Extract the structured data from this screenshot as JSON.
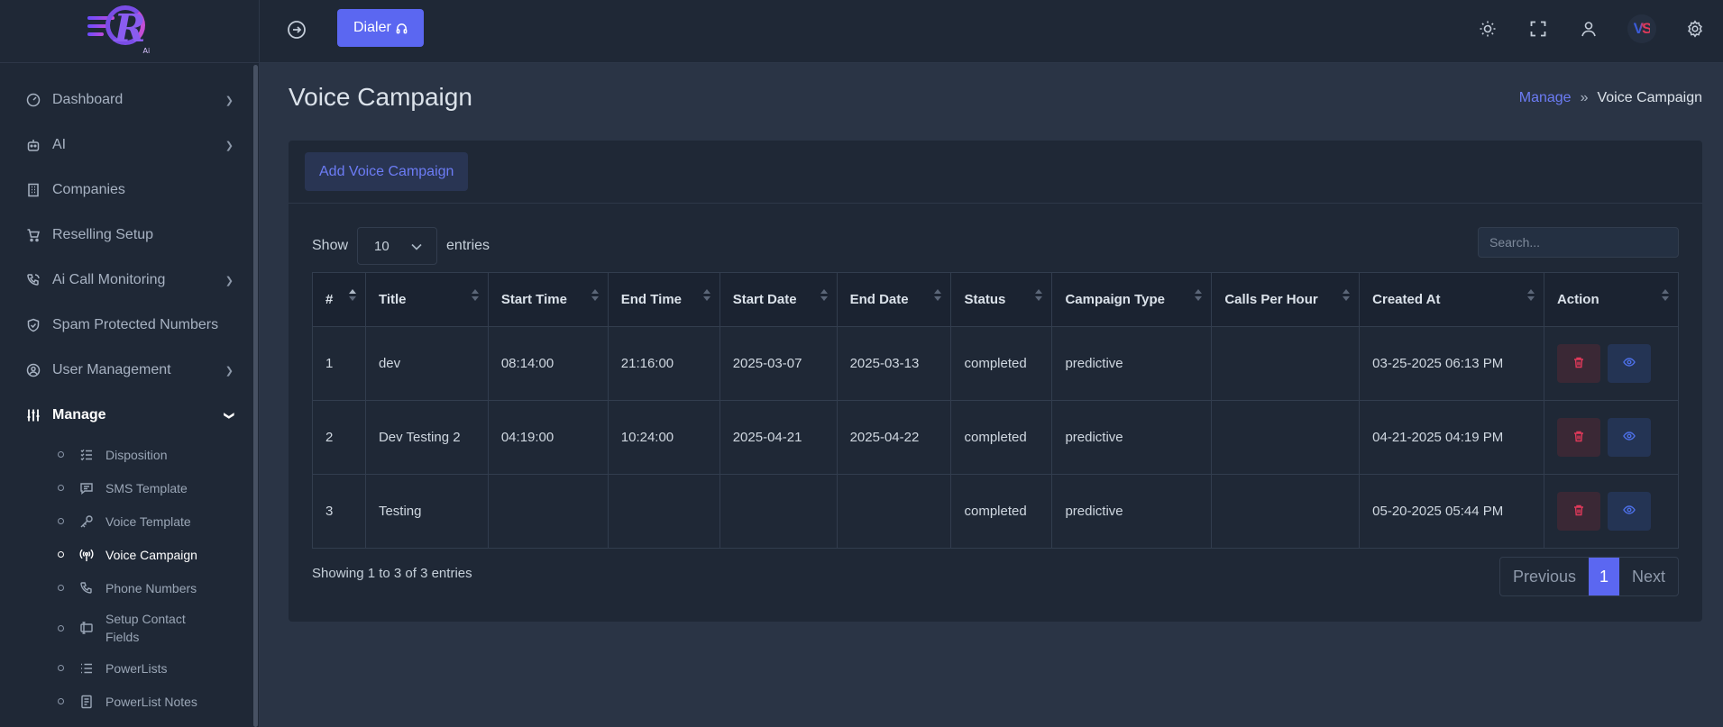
{
  "sidebar": {
    "items": [
      {
        "label": "Dashboard",
        "icon": "gauge-icon",
        "chevron": true
      },
      {
        "label": "AI",
        "icon": "robot-icon",
        "chevron": true
      },
      {
        "label": "Companies",
        "icon": "building-icon",
        "chevron": false
      },
      {
        "label": "Reselling Setup",
        "icon": "cart-icon",
        "chevron": false
      },
      {
        "label": "Ai Call Monitoring",
        "icon": "phone-call-icon",
        "chevron": true
      },
      {
        "label": "Spam Protected Numbers",
        "icon": "shield-icon",
        "chevron": false
      },
      {
        "label": "User Management",
        "icon": "user-circle-icon",
        "chevron": true
      },
      {
        "label": "Manage",
        "icon": "sliders-icon",
        "chevron": true
      }
    ],
    "sub_items": [
      {
        "label": "Disposition",
        "icon": "checklist-icon"
      },
      {
        "label": "SMS Template",
        "icon": "message-icon"
      },
      {
        "label": "Voice Template",
        "icon": "key-icon"
      },
      {
        "label": "Voice Campaign",
        "icon": "broadcast-icon"
      },
      {
        "label": "Phone Numbers",
        "icon": "phone-icon"
      },
      {
        "label": "Setup Contact Fields",
        "icon": "form-icon"
      },
      {
        "label": "PowerLists",
        "icon": "list-icon"
      },
      {
        "label": "PowerList Notes",
        "icon": "note-icon"
      }
    ]
  },
  "topbar": {
    "dialer_label": "Dialer",
    "avatar_text": "VS"
  },
  "page": {
    "title": "Voice Campaign",
    "breadcrumb": {
      "parent": "Manage",
      "current": "Voice Campaign"
    }
  },
  "card": {
    "add_label": "Add Voice Campaign",
    "show_label": "Show",
    "entries_value": "10",
    "entries_label": "entries",
    "search_placeholder": "Search..."
  },
  "table": {
    "columns": [
      "#",
      "Title",
      "Start Time",
      "End Time",
      "Start Date",
      "End Date",
      "Status",
      "Campaign Type",
      "Calls Per Hour",
      "Created At",
      "Action"
    ],
    "rows": [
      {
        "num": "1",
        "title": "dev",
        "start_time": "08:14:00",
        "end_time": "21:16:00",
        "start_date": "2025-03-07",
        "end_date": "2025-03-13",
        "status": "completed",
        "type": "predictive",
        "cph": "",
        "created": "03-25-2025 06:13 PM"
      },
      {
        "num": "2",
        "title": "Dev Testing 2",
        "start_time": "04:19:00",
        "end_time": "10:24:00",
        "start_date": "2025-04-21",
        "end_date": "2025-04-22",
        "status": "completed",
        "type": "predictive",
        "cph": "",
        "created": "04-21-2025 04:19 PM"
      },
      {
        "num": "3",
        "title": "Testing",
        "start_time": "",
        "end_time": "",
        "start_date": "",
        "end_date": "",
        "status": "completed",
        "type": "predictive",
        "cph": "",
        "created": "05-20-2025 05:44 PM"
      }
    ]
  },
  "footer": {
    "info": "Showing 1 to 3 of 3 entries",
    "prev": "Previous",
    "page": "1",
    "next": "Next"
  },
  "colors": {
    "primary": "#5b67f1",
    "sidebar_bg": "#1f2836",
    "body_bg": "#2a3445",
    "danger": "#e0395a",
    "info": "#4c6fe6"
  }
}
